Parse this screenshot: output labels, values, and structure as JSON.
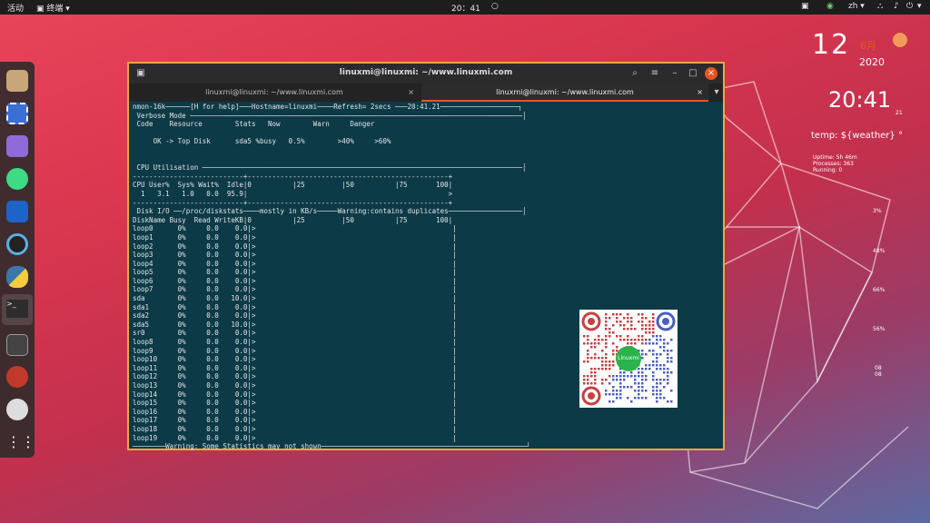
{
  "topbar": {
    "activities": "活动",
    "app_menu": "终端",
    "clock": "20：41",
    "lang": "zh"
  },
  "window": {
    "title": "linuxmi@linuxmi: ~/www.linuxmi.com",
    "tabs": [
      {
        "label": "linuxmi@linuxmi: ~/www.linuxmi.com",
        "active": false
      },
      {
        "label": "linuxmi@linuxmi: ~/www.linuxmi.com",
        "active": true
      }
    ]
  },
  "terminal": {
    "lines": [
      "nmon-16k──────[H for help]───Hostname=linuxmi────Refresh= 2secs ───20:41.21───────────────────┐",
      " Verbose Mode ─────────────────────────────────────────────────────────────────────────────────│",
      " Code    Resource        Stats   Now        Warn     Danger",
      "",
      "     OK -> Top Disk      sda5 %busy   0.5%        >40%     >60%",
      "",
      "",
      " CPU Utilisation ──────────────────────────────────────────────────────────────────────────────│",
      "---------------------------+-------------------------------------------------+",
      "CPU User%  Sys% Wait%  Idle|0          |25         |50          |75       100|",
      "  1   3.1   1.0   0.0  95.9|                                                 >",
      "---------------------------+-------------------------------------------------+",
      " Disk I/O ──/proc/diskstats────mostly in KB/s─────Warning:contains duplicates──────────────────│",
      "DiskName Busy  Read WriteKB|0          |25         |50          |75       100|",
      "loop0      0%     0.0    0.0|>                                                |",
      "loop1      0%     0.0    0.0|>                                                |",
      "loop2      0%     0.0    0.0|>                                                |",
      "loop3      0%     0.0    0.0|>                                                |",
      "loop4      0%     0.0    0.0|>                                                |",
      "loop5      0%     0.0    0.0|>                                                |",
      "loop6      0%     0.0    0.0|>                                                |",
      "loop7      0%     0.0    0.0|>                                                |",
      "sda        0%     0.0   10.0|>                                                |",
      "sda1       0%     0.0    0.0|>                                                |",
      "sda2       0%     0.0    0.0|>                                                |",
      "sda5       0%     0.0   10.0|>                                                |",
      "sr0        0%     0.0    0.0|>                                                |",
      "loop8      0%     0.0    0.0|>                                                |",
      "loop9      0%     0.0    0.0|>                                                |",
      "loop10     0%     0.0    0.0|>                                                |",
      "loop11     0%     0.0    0.0|>                                                |",
      "loop12     0%     0.0    0.0|>                                                |",
      "loop13     0%     0.0    0.0|>                                                |",
      "loop14     0%     0.0    0.0|>                                                |",
      "loop15     0%     0.0    0.0|>                                                |",
      "loop16     0%     0.0    0.0|>                                                |",
      "loop17     0%     0.0    0.0|>                                                |",
      "loop18     0%     0.0    0.0|>                                                |",
      "loop19     0%     0.0    0.0|>                                                |",
      "────────Warning: Some Statistics may not shown──────────────────────────────────────────────────┘"
    ]
  },
  "widget": {
    "day": "12",
    "month": "6月",
    "year": "2020",
    "time": "20:41",
    "seconds": "21",
    "temp": "temp: ${weather} °",
    "uptime": "Uptime: 5h 46m",
    "processes": "Processes: 363",
    "running": "Running: 0",
    "cpu_pct": "3%",
    "val_48": "48%",
    "val_66": "66%",
    "val_56": "56%",
    "val_08a": "08",
    "val_08b": "08"
  },
  "qr": {
    "label": "Linuxmi"
  },
  "colors": {
    "accent": "#e95420",
    "terminal_bg": "#0d3a47",
    "window_border": "#e8a93c"
  }
}
